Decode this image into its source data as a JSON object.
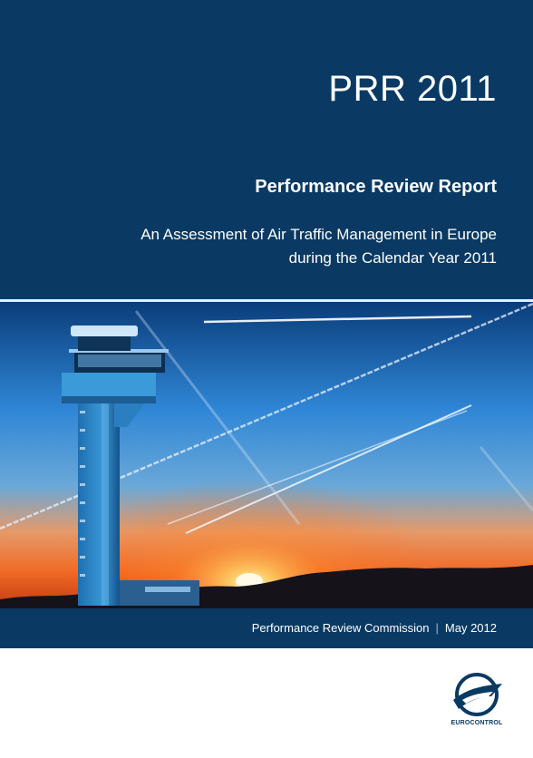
{
  "cover": {
    "code": "PRR 2011",
    "title": "Performance Review Report",
    "subtitle_line1": "An Assessment of Air Traffic Management in Europe",
    "subtitle_line2": "during the Calendar Year 2011"
  },
  "footer": {
    "publisher": "Performance Review Commission",
    "separator": "|",
    "date": "May 2012"
  },
  "logo": {
    "name": "EUROCONTROL",
    "icon": "eurocontrol-emblem-icon"
  },
  "colors": {
    "band": "#0a3a63",
    "sky_top": "#0a3d7a",
    "sky_mid": "#2f86d6",
    "sunset": "#f06a25",
    "tower": "#2a87c8"
  }
}
